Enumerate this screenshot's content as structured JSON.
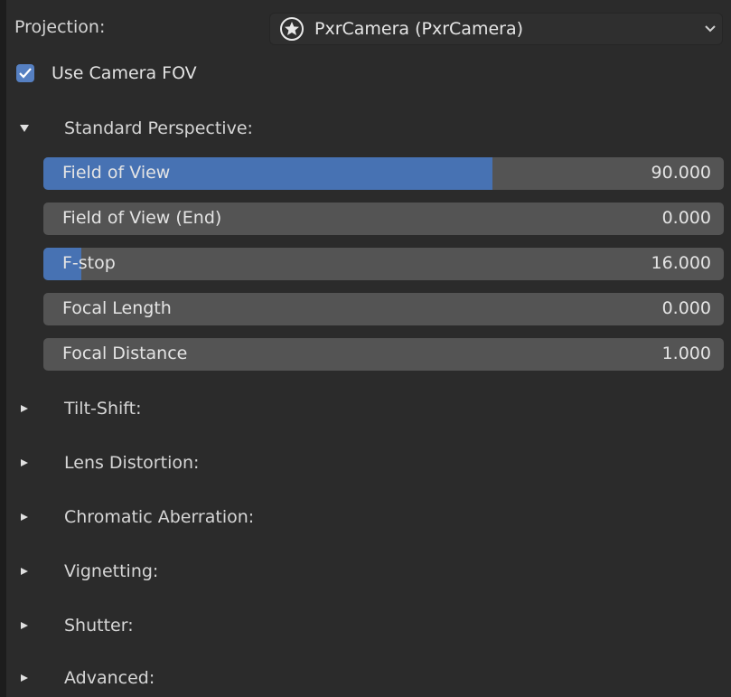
{
  "projection": {
    "label": "Projection:",
    "value": "PxrCamera (PxrCamera)",
    "icon": "star-circle-icon"
  },
  "use_camera_fov": {
    "label": "Use Camera FOV",
    "checked": true
  },
  "standard_perspective": {
    "label": "Standard Perspective:",
    "expanded": true,
    "fields": [
      {
        "label": "Field of View",
        "value": "90.000",
        "fill": 0.66
      },
      {
        "label": "Field of View (End)",
        "value": "0.000",
        "fill": 0
      },
      {
        "label": "F-stop",
        "value": "16.000",
        "fill": 0.056
      },
      {
        "label": "Focal Length",
        "value": "0.000",
        "fill": 0
      },
      {
        "label": "Focal Distance",
        "value": "1.000",
        "fill": 0
      }
    ]
  },
  "collapsed_sections": [
    {
      "label": "Tilt-Shift:"
    },
    {
      "label": "Lens Distortion:"
    },
    {
      "label": "Chromatic Aberration:"
    },
    {
      "label": "Vignetting:"
    },
    {
      "label": "Shutter:"
    },
    {
      "label": "Advanced:"
    }
  ],
  "colors": {
    "accent": "#4772b3",
    "field_bg": "#545454",
    "panel_bg": "#2b2b2b",
    "checkbox": "#5680c2"
  }
}
